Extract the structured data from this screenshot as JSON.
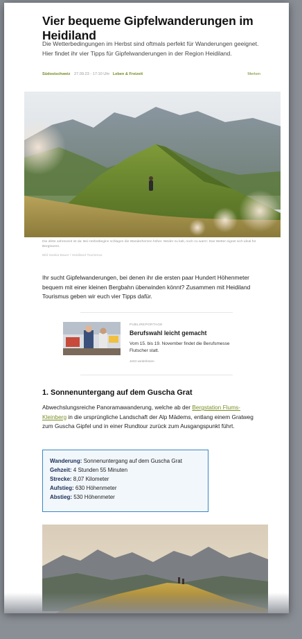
{
  "article": {
    "title": "Vier bequeme Gipfelwanderungen im Heidiland",
    "lead": "Die Wetterbedingungen im Herbst sind oftmals perfekt für Wanderungen geeignet. Hier findet ihr vier Tipps für Gipfelwanderungen in der Region Heidiland.",
    "meta": {
      "region": "Südostschweiz",
      "date": "27.09.23 - 17:10 Uhr",
      "category": "Leben & Freizeit",
      "bookmark": "Merken"
    },
    "hero_caption": "Die dritte Jahreszeit ist da: Bei Herbstbeginn schlagen die Wanderherzen höher. Weder zu kalt, noch zu warm: Das Wetter eignet sich ideal für Bergtouren.",
    "hero_credit": "Bild Saskia Bauer / Heidiland Tourismus",
    "intro": "Ihr sucht Gipfelwanderungen, bei denen ihr die ersten paar Hundert Höhenmeter bequem mit einer kleinen Bergbahn überwinden könnt? Zusammen mit Heidiland Tourismus geben wir euch vier Tipps dafür."
  },
  "promo": {
    "kicker": "PUBLIREPORTAGE",
    "title": "Berufswahl leicht gemacht",
    "description": "Vom 15. bis 19. November findet die Berufsmesse Flutscher statt.",
    "link": "Jetzt weiterlesen"
  },
  "section1": {
    "heading": "1. Sonnenuntergang auf dem Guscha Grat",
    "text_before": "Abwechslungsreiche Panoramawanderung, welche ab der ",
    "link": "Bergstation Flums-Kleinberg",
    "text_after": " in die ursprüngliche Landschaft der Alp Mädems, entlang einem Gratweg zum Guscha Gipfel und in einer Rundtour zurück zum Ausgangspunkt führt.",
    "info": {
      "wanderung_label": "Wanderung:",
      "wanderung_value": " Sonnenuntergang auf dem Guscha Grat",
      "gehzeit_label": "Gehzeit:",
      "gehzeit_value": " 4 Stunden 55 Minuten",
      "strecke_label": "Strecke:",
      "strecke_value": " 8,07 Kilometer",
      "aufstieg_label": "Aufstieg:",
      "aufstieg_value": " 630 Höhenmeter",
      "abstieg_label": "Abstieg:",
      "abstieg_value": " 530 Höhenmeter"
    }
  },
  "colors": {
    "accent_green": "#6f8a20",
    "infobox_border": "#3a86bf",
    "infobox_bg": "#f2f7fc"
  }
}
